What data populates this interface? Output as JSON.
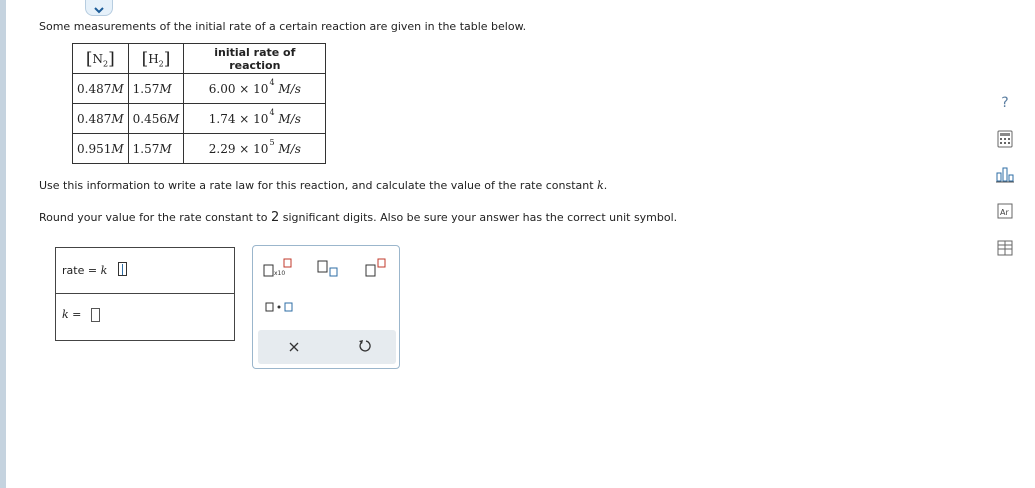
{
  "header": {
    "collapse_icon": "chevron-down-icon"
  },
  "question": {
    "intro": "Some measurements of the initial rate of a certain reaction are given in the table below.",
    "instruction_pre": "Use this information to write a rate law for this reaction, and calculate the value of the rate constant ",
    "instruction_var": "k",
    "instruction_post": ".",
    "round_pre": "Round your value for the rate constant to ",
    "round_digits": "2",
    "round_post": " significant digits. Also be sure your answer has the correct unit symbol."
  },
  "table": {
    "headers": {
      "n2_symbol": "N",
      "n2_sub": "2",
      "h2_symbol": "H",
      "h2_sub": "2",
      "rate": "initial rate of reaction"
    },
    "rows": [
      {
        "n2": "0.487",
        "n2_unit": "M",
        "h2": "1.57",
        "h2_unit": "M",
        "rate_mant": "6.00 × 10",
        "rate_exp": "4",
        "rate_unit": "M/s"
      },
      {
        "n2": "0.487",
        "n2_unit": "M",
        "h2": "0.456",
        "h2_unit": "M",
        "rate_mant": "1.74 × 10",
        "rate_exp": "4",
        "rate_unit": "M/s"
      },
      {
        "n2": "0.951",
        "n2_unit": "M",
        "h2": "1.57",
        "h2_unit": "M",
        "rate_mant": "2.29 × 10",
        "rate_exp": "5",
        "rate_unit": "M/s"
      }
    ]
  },
  "answer": {
    "rate_label": "rate",
    "equals": "=",
    "rate_k": "k",
    "k_label": "k",
    "k_equals": "="
  },
  "palette": {
    "times_ten_label": "x10",
    "buttons": [
      "times-ten-button",
      "subscript-button",
      "superscript-button",
      "multiply-dot-button",
      "clear-button",
      "undo-button"
    ]
  },
  "sidebar": {
    "help_label": "?",
    "tools": [
      "help-icon",
      "calculator-icon",
      "chart-icon",
      "periodic-table-icon",
      "data-table-icon"
    ]
  },
  "colors": {
    "accent": "#2e6da4",
    "palette_border": "#9bb6cc",
    "left_strip": "#c5d3df"
  }
}
